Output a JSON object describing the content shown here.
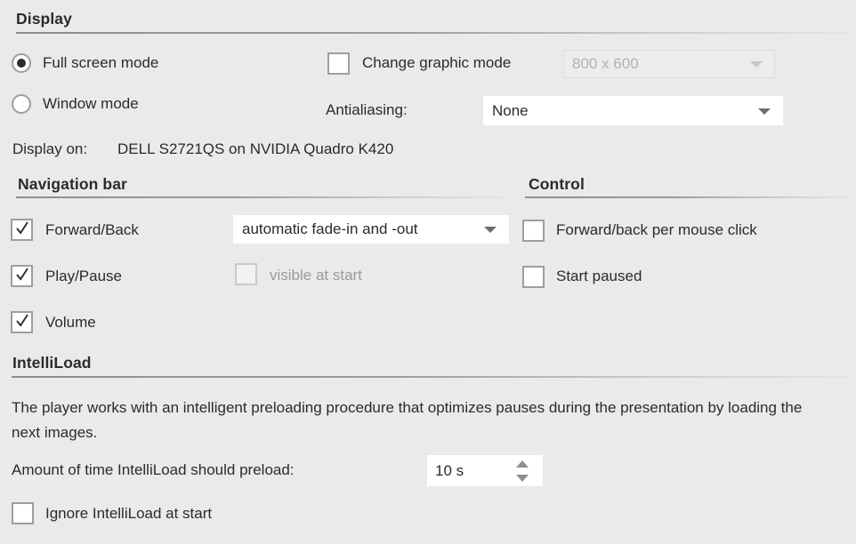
{
  "sections": {
    "display": {
      "title": "Display",
      "mode_options": [
        {
          "label": "Full screen mode",
          "selected": true
        },
        {
          "label": "Window mode",
          "selected": false
        }
      ],
      "change_graphic_mode": {
        "label": "Change graphic mode",
        "checked": false
      },
      "resolution": {
        "value": "800 x 600",
        "enabled": false
      },
      "antialiasing": {
        "label": "Antialiasing:",
        "value": "None"
      },
      "display_on": {
        "label": "Display on:",
        "value": "DELL S2721QS on NVIDIA Quadro K420"
      }
    },
    "navigation_bar": {
      "title": "Navigation bar",
      "items": [
        {
          "label": "Forward/Back",
          "checked": true
        },
        {
          "label": "Play/Pause",
          "checked": true
        },
        {
          "label": "Volume",
          "checked": true
        }
      ],
      "fade_mode": {
        "value": "automatic fade-in and -out"
      },
      "visible_at_start": {
        "label": "visible at start",
        "checked": false,
        "enabled": false
      }
    },
    "control": {
      "title": "Control",
      "items": [
        {
          "label": "Forward/back per mouse click",
          "checked": false
        },
        {
          "label": "Start paused",
          "checked": false
        }
      ]
    },
    "intelliload": {
      "title": "IntelliLoad",
      "description": "The player works with an intelligent preloading procedure that optimizes pauses during the presentation by loading the next images.",
      "preload_label": "Amount of time IntelliLoad should preload:",
      "preload_value": "10 s",
      "ignore_at_start": {
        "label": "Ignore IntelliLoad at start",
        "checked": false
      }
    }
  },
  "colors": {
    "background": "#eaeaea",
    "text": "#2b2b2b",
    "disabled_text": "#9b9b9b",
    "control_border": "#9e9e9e",
    "field_background": "#ffffff"
  }
}
